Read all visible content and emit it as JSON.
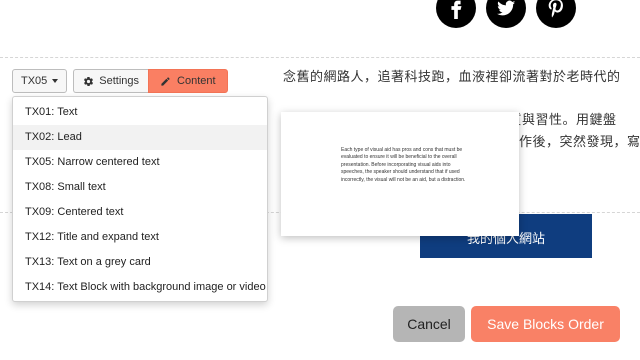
{
  "social": {
    "icons": [
      "facebook-icon",
      "twitter-icon",
      "pinterest-icon"
    ],
    "color": "#000000"
  },
  "toolbar": {
    "template_select": "TX05",
    "settings_label": "Settings",
    "content_label": "Content",
    "accent": "#fa7f63"
  },
  "dropdown": {
    "items": [
      "TX01: Text",
      "TX02: Lead",
      "TX05: Narrow centered text",
      "TX08: Small text",
      "TX09: Centered text",
      "TX12: Title and expand text",
      "TX13: Text on a grey card",
      "TX14: Text Block with background image or video"
    ],
    "hovered_index": 1
  },
  "content": {
    "line1": "念舊的網路人，追著科技跑，血液裡卻流著對於老時代的",
    "line2": "用鍵盤",
    "line2_prefix": "特質與習性。",
    "line3": "作後，突然發現，寫",
    "preview_text": "Each type of visual aid has pros and cons that must be evaluated to ensure it will be beneficial to the overall presentation. Before incorporating visual aids into speeches, the speaker should understand that if used incorrectly, the visual will not be an aid, but a distraction.",
    "site_button": "我的個人網站"
  },
  "footer": {
    "cancel_label": "Cancel",
    "save_label": "Save Blocks Order",
    "save_color": "#f98166",
    "site_button_color": "#0f3d7f"
  }
}
